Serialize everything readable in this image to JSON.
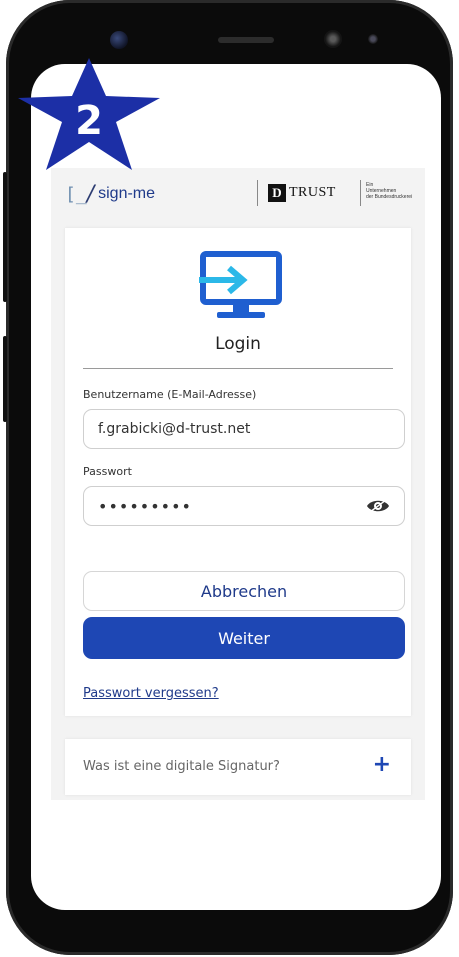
{
  "badge": {
    "number": "2",
    "color": "#1c2fa6"
  },
  "header": {
    "logo_text": "sign-me",
    "dtrust_letter": "D",
    "dtrust_text": "TRUST",
    "company_note": [
      "Ein",
      "Unternehmen",
      "der Bundesdruckerei"
    ]
  },
  "login": {
    "title": "Login",
    "username_label": "Benutzername (E-Mail-Adresse)",
    "username_value": "f.grabicki@d-trust.net",
    "password_label": "Passwort",
    "password_value": "•••••••••",
    "cancel_label": "Abbrechen",
    "next_label": "Weiter",
    "forgot_link": "Passwort vergessen?"
  },
  "faq": {
    "question": "Was ist eine digitale Signatur?",
    "expand_symbol": "+"
  },
  "colors": {
    "accent": "#1e47b4",
    "monitor": "#1f5fd0",
    "arrow": "#2bb8e8"
  },
  "icons": [
    "login-monitor-icon",
    "eye-icon",
    "star-icon",
    "plus-icon"
  ]
}
